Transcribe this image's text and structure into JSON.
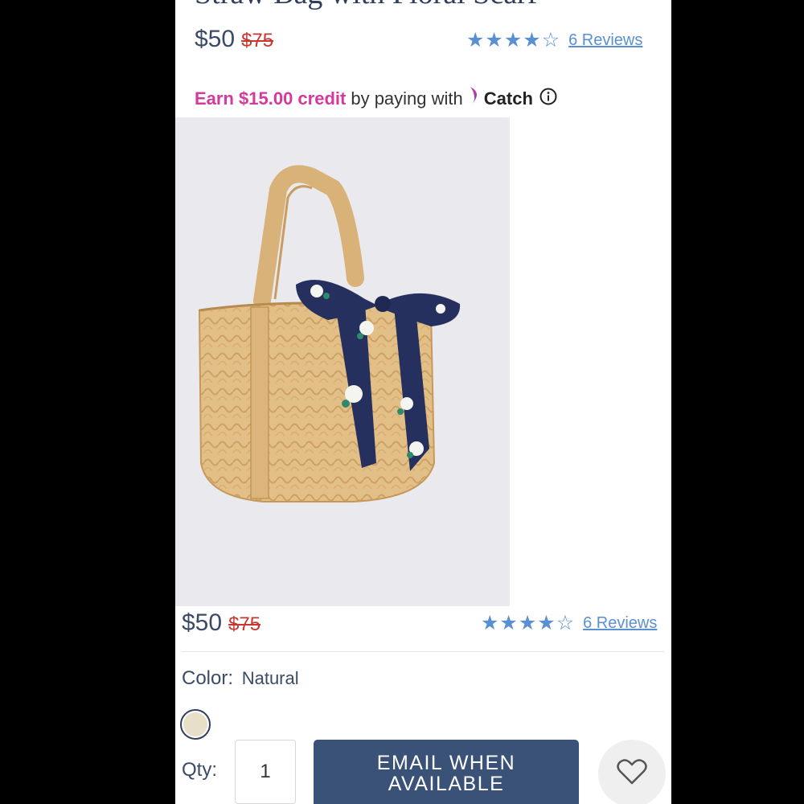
{
  "product": {
    "title": "Straw Bag with Floral Scarf",
    "price": "$50",
    "original_price": "$75",
    "rating_stars": 4,
    "rating_max": 5,
    "reviews_label": "6 Reviews"
  },
  "credit": {
    "earn_text": "Earn $15.00 credit",
    "by_text": "by paying with",
    "brand": "Catch"
  },
  "options": {
    "color_label": "Color:",
    "color_value": "Natural",
    "qty_label": "Qty:",
    "qty_value": "1"
  },
  "actions": {
    "email_line1": "EMAIL WHEN",
    "email_line2": "AVAILABLE"
  },
  "colors": {
    "accent_blue": "#5b8fd4",
    "sale_red": "#c8372d",
    "catch_pink": "#d4399c",
    "button_navy": "#3b5278",
    "text_navy": "#3b4a66"
  },
  "icons": [
    "star-icon",
    "info-icon",
    "catch-logo-icon",
    "heart-icon"
  ]
}
